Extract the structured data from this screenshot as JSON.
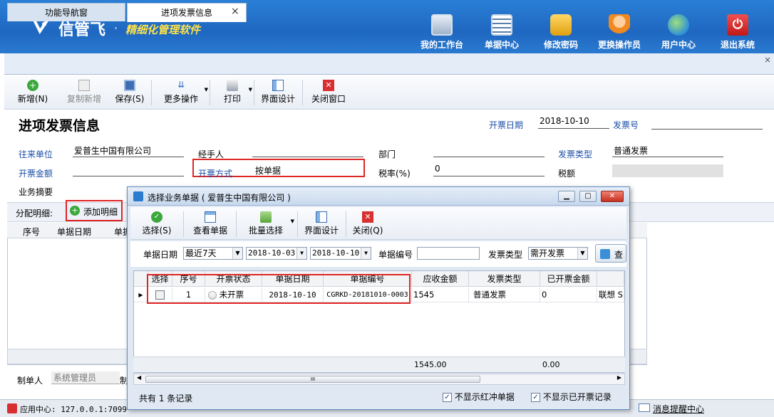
{
  "app": {
    "brand": "信管飞",
    "dot": "·",
    "slogan": "精细化管理软件"
  },
  "header_buttons": [
    {
      "label": "我的工作台",
      "icon": "monitor-icon"
    },
    {
      "label": "单据中心",
      "icon": "document-list-icon"
    },
    {
      "label": "修改密码",
      "icon": "lock-icon"
    },
    {
      "label": "更换操作员",
      "icon": "user-icon"
    },
    {
      "label": "用户中心",
      "icon": "globe-icon"
    },
    {
      "label": "退出系统",
      "icon": "power-icon"
    }
  ],
  "tabs": {
    "nav": "功能导航窗",
    "invoice": "进项发票信息",
    "close": "×"
  },
  "app_close": "×",
  "toolbar": {
    "new": "新增(N)",
    "copy_new": "复制新增",
    "save": "保存(S)",
    "more": "更多操作",
    "print": "打印",
    "design": "界面设计",
    "close_window": "关闭窗口"
  },
  "form": {
    "title": "进项发票信息",
    "invoice_date_label": "开票日期",
    "invoice_date": "2018-10-10",
    "invoice_no_label": "发票号",
    "invoice_no": "",
    "partner_label": "往来单位",
    "partner": "爱普生中国有限公司",
    "handler_label": "经手人",
    "handler": "",
    "dept_label": "部门",
    "dept": "",
    "invoice_type_label": "发票类型",
    "invoice_type": "普通发票",
    "amount_label": "开票金额",
    "amount": "",
    "method_label": "开票方式",
    "method": "按单据",
    "tax_rate_label": "税率(%)",
    "tax_rate": "0",
    "tax_label": "税额",
    "tax": "",
    "summary_label": "业务摘要",
    "summary": ""
  },
  "detail": {
    "label": "分配明细:",
    "add_button": "添加明细",
    "col_seq": "序号",
    "col_date": "单据日期",
    "col_more": "单据"
  },
  "bottom": {
    "maker_label": "制单人",
    "maker": "系统管理员",
    "other_label": "制"
  },
  "statusbar": {
    "app_center": "应用中心: 127.0.0.1:7099",
    "message_center": "消息提醒中心"
  },
  "dialog": {
    "title": "选择业务单据 ( 爱普生中国有限公司 )",
    "buttons": {
      "min": "▁",
      "max": "▢",
      "close": "✕"
    },
    "toolbar": {
      "select": "选择(S)",
      "view": "查看单据",
      "batch": "批量选择",
      "design": "界面设计",
      "close": "关闭(Q)"
    },
    "filter": {
      "date_label": "单据日期",
      "date_range": "最近7天",
      "date_from": "2018-10-03",
      "date_to": "2018-10-10",
      "no_label": "单据编号",
      "no_value": "",
      "type_label": "发票类型",
      "type_value": "需开发票",
      "search": "查"
    },
    "columns": [
      "选择",
      "序号",
      "开票状态",
      "单据日期",
      "单据编号",
      "应收金额",
      "发票类型",
      "已开票金额",
      ""
    ],
    "rows": [
      {
        "seq": "1",
        "status": "未开票",
        "date": "2018-10-10",
        "no": "CGRKD-20181010-0003",
        "amount": "1545",
        "type": "普通发票",
        "invoiced": "0",
        "extra": "联想 S"
      }
    ],
    "total_amount": "1545.00",
    "total_invoiced": "0.00",
    "scroll_mark": "III",
    "record_count": "共有 1 条记录",
    "opt_hide_red": "不显示红冲单据",
    "opt_hide_invoiced": "不显示已开票记录"
  },
  "colors": {
    "header_blue": "#1f67c0",
    "slogan_yellow": "#ffe34a",
    "label_blue": "#1b4da8",
    "highlight_red": "#e02525"
  }
}
